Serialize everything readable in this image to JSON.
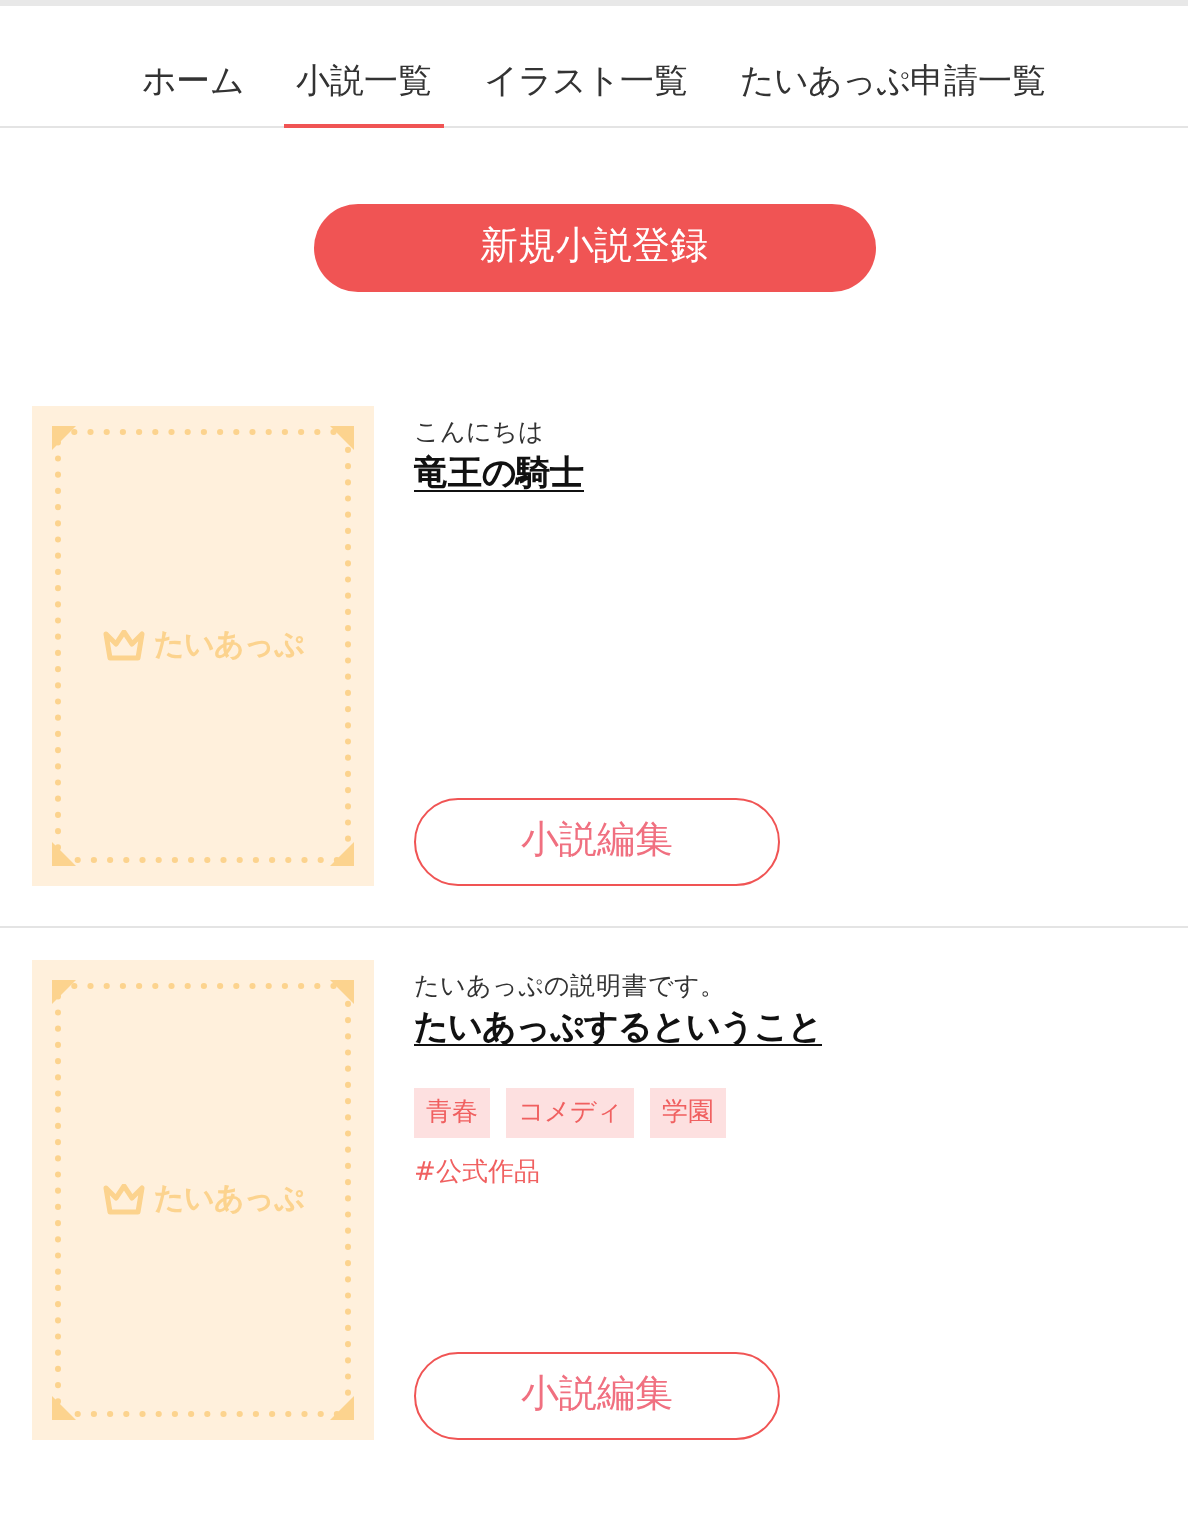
{
  "tabs": [
    {
      "label": "ホーム",
      "selected": false
    },
    {
      "label": "小説一覧",
      "selected": true
    },
    {
      "label": "イラスト一覧",
      "selected": false
    },
    {
      "label": "たいあっぷ申請一覧",
      "selected": false
    }
  ],
  "new_button": "新規小説登録",
  "novels": [
    {
      "cover_logo": "たいあっぷ",
      "subtitle": "こんにちは",
      "title": "竜王の騎士",
      "edit_button": "小説編集"
    },
    {
      "cover_logo": "たいあっぷ",
      "subtitle": "たいあっぷの説明書です。",
      "title": "たいあっぷするということ",
      "tags": [
        "青春",
        "コメディ",
        "学園"
      ],
      "hashtags": [
        "#公式作品"
      ],
      "edit_button": "小説編集"
    }
  ]
}
